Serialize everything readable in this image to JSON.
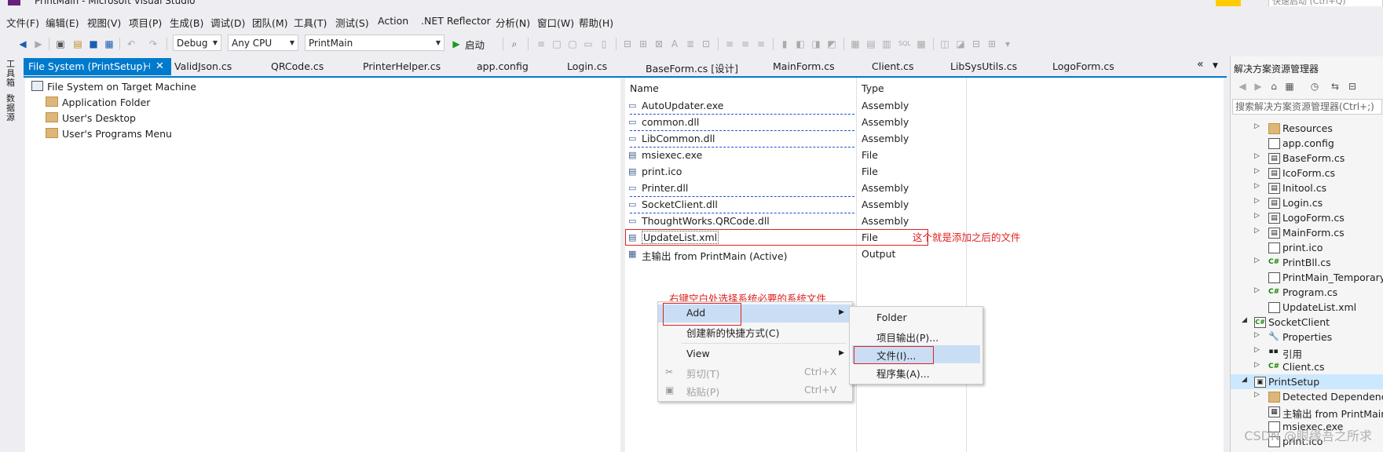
{
  "window": {
    "title": "PrintMain - Microsoft Visual Studio",
    "quick_launch": "快速启动 (Ctrl+Q)"
  },
  "menubar": {
    "items": [
      "文件(F)",
      "编辑(E)",
      "视图(V)",
      "项目(P)",
      "生成(B)",
      "调试(D)",
      "团队(M)",
      "工具(T)",
      "测试(S)",
      "Action",
      ".NET Reflector",
      "分析(N)",
      "窗口(W)",
      "帮助(H)"
    ]
  },
  "toolbar": {
    "config": "Debug",
    "platform": "Any CPU",
    "startup_project": "PrintMain",
    "start_label": "启动"
  },
  "left_strip": {
    "tab1": "工具箱",
    "tab2": "数据源"
  },
  "tabs": {
    "active": "File System (PrintSetup)",
    "others": [
      "ValidJson.cs",
      "QRCode.cs",
      "PrinterHelper.cs",
      "app.config",
      "Login.cs",
      "BaseForm.cs [设计]",
      "MainForm.cs",
      "Client.cs",
      "LibSysUtils.cs",
      "LogoForm.cs"
    ],
    "overflow": "«"
  },
  "filesystem_tree": {
    "root": "File System on Target Machine",
    "children": [
      "Application Folder",
      "User's Desktop",
      "User's Programs Menu"
    ]
  },
  "file_list": {
    "col_name": "Name",
    "col_type": "Type",
    "rows": [
      {
        "name": "AutoUpdater.exe",
        "type": "Assembly"
      },
      {
        "name": "common.dll",
        "type": "Assembly"
      },
      {
        "name": "LibCommon.dll",
        "type": "Assembly"
      },
      {
        "name": "msiexec.exe",
        "type": "File"
      },
      {
        "name": "print.ico",
        "type": "File"
      },
      {
        "name": "Printer.dll",
        "type": "Assembly"
      },
      {
        "name": "SocketClient.dll",
        "type": "Assembly"
      },
      {
        "name": "ThoughtWorks.QRCode.dll",
        "type": "Assembly"
      },
      {
        "name": "UpdateList.xml",
        "type": "File"
      },
      {
        "name": "主输出 from PrintMain (Active)",
        "type": "Output"
      }
    ]
  },
  "annotations": {
    "added_file_note": "这个就是添加之后的文件",
    "right_click_note": "右键空白处选择系统必要的系统文件"
  },
  "context_menu": {
    "add": "Add",
    "create_shortcut": "创建新的快捷方式(C)",
    "view": "View",
    "cut": "剪切(T)",
    "cut_shortcut": "Ctrl+X",
    "paste": "粘贴(P)",
    "paste_shortcut": "Ctrl+V"
  },
  "submenu": {
    "folder": "Folder",
    "project_output": "项目输出(P)...",
    "file": "文件(I)...",
    "assembly": "程序集(A)..."
  },
  "solution_explorer": {
    "title": "解决方案资源管理器",
    "search_placeholder": "搜索解决方案资源管理器(Ctrl+;)",
    "nodes": [
      {
        "label": "Resources",
        "icon": "folder"
      },
      {
        "label": "app.config",
        "icon": "file"
      },
      {
        "label": "BaseForm.cs",
        "icon": "form"
      },
      {
        "label": "IcoForm.cs",
        "icon": "form"
      },
      {
        "label": "Initool.cs",
        "icon": "form"
      },
      {
        "label": "Login.cs",
        "icon": "form"
      },
      {
        "label": "LogoForm.cs",
        "icon": "form"
      },
      {
        "label": "MainForm.cs",
        "icon": "form"
      },
      {
        "label": "print.ico",
        "icon": "file"
      },
      {
        "label": "PrintBll.cs",
        "icon": "cs"
      },
      {
        "label": "PrintMain_TemporaryK",
        "icon": "file"
      },
      {
        "label": "Program.cs",
        "icon": "cs"
      },
      {
        "label": "UpdateList.xml",
        "icon": "file"
      },
      {
        "label": "SocketClient",
        "icon": "csproj"
      },
      {
        "label": "Properties",
        "icon": "wrench"
      },
      {
        "label": "引用",
        "icon": "ref"
      },
      {
        "label": "Client.cs",
        "icon": "cs"
      },
      {
        "label": "PrintSetup",
        "icon": "setup"
      },
      {
        "label": "Detected Dependencie",
        "icon": "folder"
      },
      {
        "label": "主输出 from PrintMain",
        "icon": "output"
      },
      {
        "label": "msiexec.exe",
        "icon": "file"
      },
      {
        "label": "print.ico",
        "icon": "file"
      }
    ]
  },
  "watermark": "CSDN @眼缘吾之所求",
  "colors": {
    "accent": "#007acc",
    "annotation_red": "#e02020",
    "menu_highlight": "#c9def5"
  }
}
